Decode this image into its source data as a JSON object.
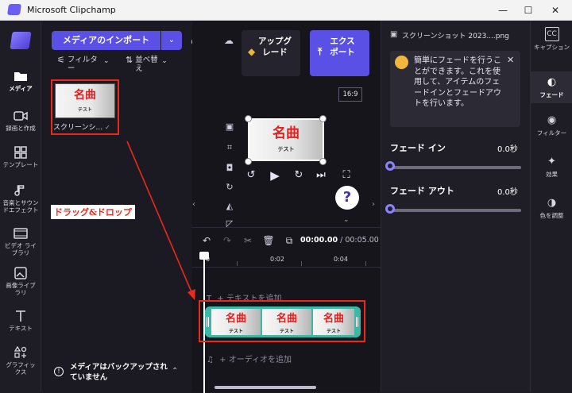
{
  "window": {
    "title": "Microsoft Clipchamp",
    "min": "—",
    "max": "☐",
    "close": "✕"
  },
  "left_nav": [
    {
      "label": "メディア",
      "icon": "folder-icon"
    },
    {
      "label": "録画と作成",
      "icon": "camera-icon"
    },
    {
      "label": "テンプレート",
      "icon": "templates-icon"
    },
    {
      "label": "音楽とサウンドエフェクト",
      "icon": "music-icon"
    },
    {
      "label": "ビデオ ライブラリ",
      "icon": "video-library-icon"
    },
    {
      "label": "画像ライブラリ",
      "icon": "image-library-icon"
    },
    {
      "label": "テキスト",
      "icon": "text-icon"
    },
    {
      "label": "グラフィックス",
      "icon": "graphics-icon"
    }
  ],
  "media": {
    "import_label": "メディアのインポート",
    "filter_label": "フィルター",
    "sort_label": "並べ替え",
    "thumb_title": "名曲",
    "thumb_sub": "テスト",
    "thumb_name": "スクリーンシ...",
    "annotation": "ドラッグ&ドロップ",
    "backup_note": "メディアはバックアップされていません"
  },
  "preview": {
    "upgrade_label": "アップグレード",
    "export_label": "エクスポート",
    "aspect": "16:9",
    "frame_title": "名曲",
    "frame_sub": "テスト",
    "help": "?"
  },
  "timeline": {
    "time_current": "00:00.00",
    "time_total": "/ 00:05.00",
    "ruler": [
      "0",
      "0:02",
      "0:04"
    ],
    "add_text": "+ テキストを追加",
    "add_audio": "+ オーディオを追加",
    "clip_title": "名曲",
    "clip_sub": "テスト"
  },
  "props": {
    "filename": "スクリーンショット 2023....png",
    "tip": "簡単にフェードを行うことができます。これを使用して、アイテムのフェードインとフェードアウトを行います。",
    "fade_in_label": "フェード イン",
    "fade_in_value": "0.0秒",
    "fade_out_label": "フェード アウト",
    "fade_out_value": "0.0秒"
  },
  "right_nav": [
    {
      "label": "キャプション",
      "icon": "captions-icon",
      "glyph": "CC"
    },
    {
      "label": "フェード",
      "icon": "fade-icon",
      "glyph": "◐"
    },
    {
      "label": "フィルター",
      "icon": "filter-icon",
      "glyph": "◉"
    },
    {
      "label": "効果",
      "icon": "effects-icon",
      "glyph": "✦"
    },
    {
      "label": "色を調整",
      "icon": "color-adjust-icon",
      "glyph": "◑"
    }
  ],
  "accent": "#5b50e6",
  "annotation_color": "#e8291c"
}
